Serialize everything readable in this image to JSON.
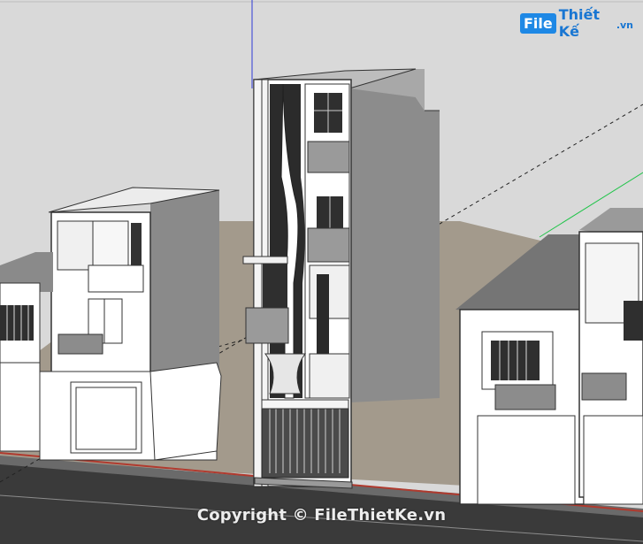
{
  "logo": {
    "badge": "File",
    "name": "Thiết Kế",
    "tld": ".vn"
  },
  "watermark": {
    "text": "Copyright © FileThietKe.vn"
  },
  "colors": {
    "sky": "#d9d9d9",
    "ground": "#a39a8c",
    "road": "#3d3d3d",
    "wall_light": "#ffffff",
    "wall_shade": "#8a8a8a",
    "roof": "#757575",
    "axis_green": "#21c44a",
    "axis_blue": "#2e3bd6",
    "axis_red": "#b03a2e",
    "logo_blue": "#1e88e5"
  },
  "scene": {
    "description_icons": [
      "sketchup-model",
      "building-icon"
    ]
  }
}
